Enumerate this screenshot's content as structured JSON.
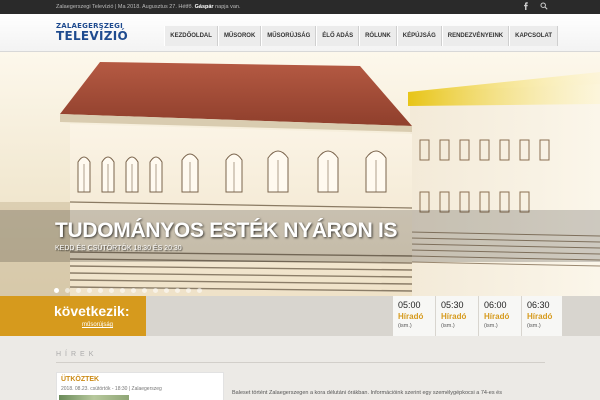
{
  "topbar": {
    "message_prefix": "Zalaegerszegi Televízió | Ma 2018. Augusztus 27. Hétfő. ",
    "nameday_name": "Gáspár",
    "message_suffix": " napja van.",
    "icons": [
      "facebook-icon",
      "search-icon"
    ]
  },
  "logo": {
    "line1": "ZALAEGERSZEGI",
    "line2": "TELEVÍZIÓ"
  },
  "nav": {
    "items": [
      "KEZDŐOLDAL",
      "MŰSOROK",
      "MŰSORÚJSÁG",
      "ÉLŐ ADÁS",
      "RÓLUNK",
      "KÉPÚJSÁG",
      "RENDEZVÉNYEINK",
      "KAPCSOLAT"
    ]
  },
  "hero": {
    "title": "TUDOMÁNYOS ESTÉK NYÁRON IS",
    "subtitle": "KEDD ÉS CSÜTÖRTÖK 18:30 ÉS 20:30",
    "slide_count": 14,
    "active_slide": 0
  },
  "schedule": {
    "heading": "következik:",
    "link": "műsorújság",
    "slots": [
      {
        "time": "05:00",
        "show": "Híradó",
        "note": "(ism.)"
      },
      {
        "time": "05:30",
        "show": "Híradó",
        "note": "(ism.)"
      },
      {
        "time": "06:00",
        "show": "Híradó",
        "note": "(ism.)"
      },
      {
        "time": "06:30",
        "show": "Híradó",
        "note": "(ism.)"
      }
    ]
  },
  "news": {
    "section_title": "HÍREK",
    "card": {
      "headline": "ÜTKÖZTEK",
      "meta": "2018. 08.23. csütörtök - 18:30 | Zalaegerszeg"
    },
    "excerpt": "Baleset történt Zalaegerszegen a kora délutáni órákban. Információink szerint egy személygépkocsi a 74-es és"
  },
  "colors": {
    "accent": "#d69a1d",
    "brand": "#1f4b8f",
    "topbar": "#2a2a2a"
  }
}
